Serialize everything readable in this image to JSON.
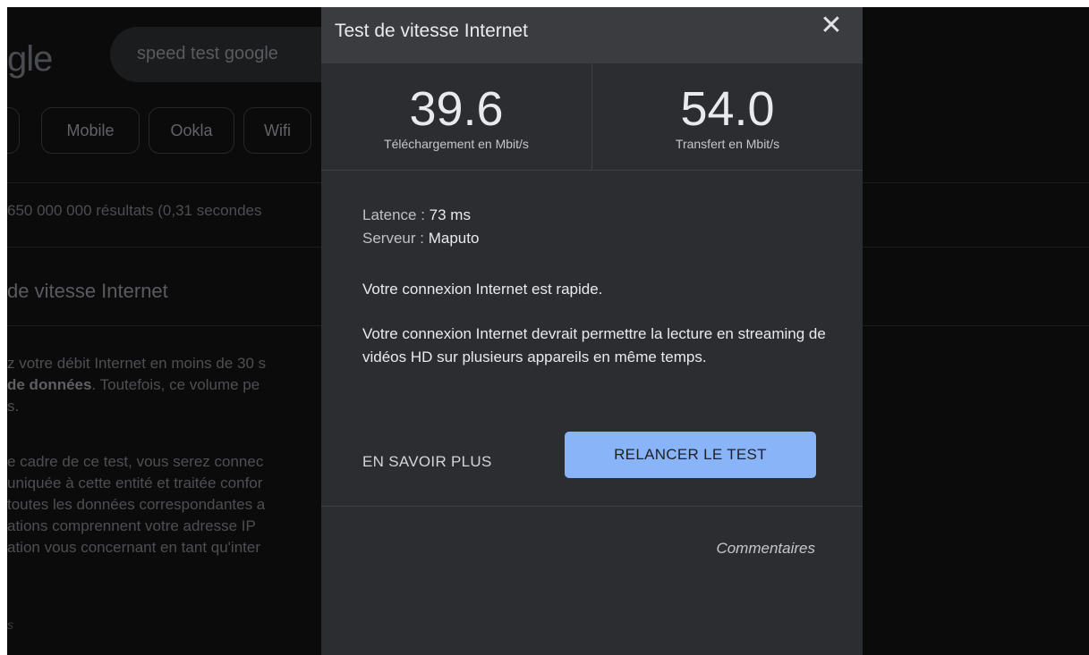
{
  "background": {
    "logo": "gle",
    "search_query": "speed test google",
    "chips": [
      "Mobile",
      "Ookla",
      "Wifi"
    ],
    "results_count": "650 000 000 résultats (0,31 secondes",
    "heading": "de vitesse Internet",
    "para1_lines": [
      "z votre débit Internet en moins de 30 s",
      "de données",
      ". Toutefois, ce volume pe",
      "s."
    ],
    "para2_lines": [
      "e cadre de ce test, vous serez connec",
      "uniquée à cette entité et traitée confor",
      "toutes les données correspondantes a",
      "ations comprennent votre adresse IP",
      "ation vous concernant en tant qu'inter"
    ],
    "small_text": "s"
  },
  "dialog": {
    "title": "Test de vitesse Internet",
    "close_icon": "close-icon",
    "download_value": "39.6",
    "download_label": "Téléchargement en Mbit/s",
    "upload_value": "54.0",
    "upload_label": "Transfert en Mbit/s",
    "latency_label": "Latence : ",
    "latency_value": "73 ms",
    "server_label": "Serveur : ",
    "server_value": "Maputo",
    "message1": "Votre connexion Internet est rapide.",
    "message2": "Votre connexion Internet devrait permettre la lecture en streaming de vidéos HD sur plusieurs appareils en même temps.",
    "learn_more_button": "EN SAVOIR PLUS",
    "rerun_button": "RELANCER LE TEST",
    "feedback_link": "Commentaires"
  },
  "colors": {
    "accent": "#8ab4f8",
    "dialog_bg": "#2c2d30",
    "header_bg": "#3b3c3f"
  }
}
